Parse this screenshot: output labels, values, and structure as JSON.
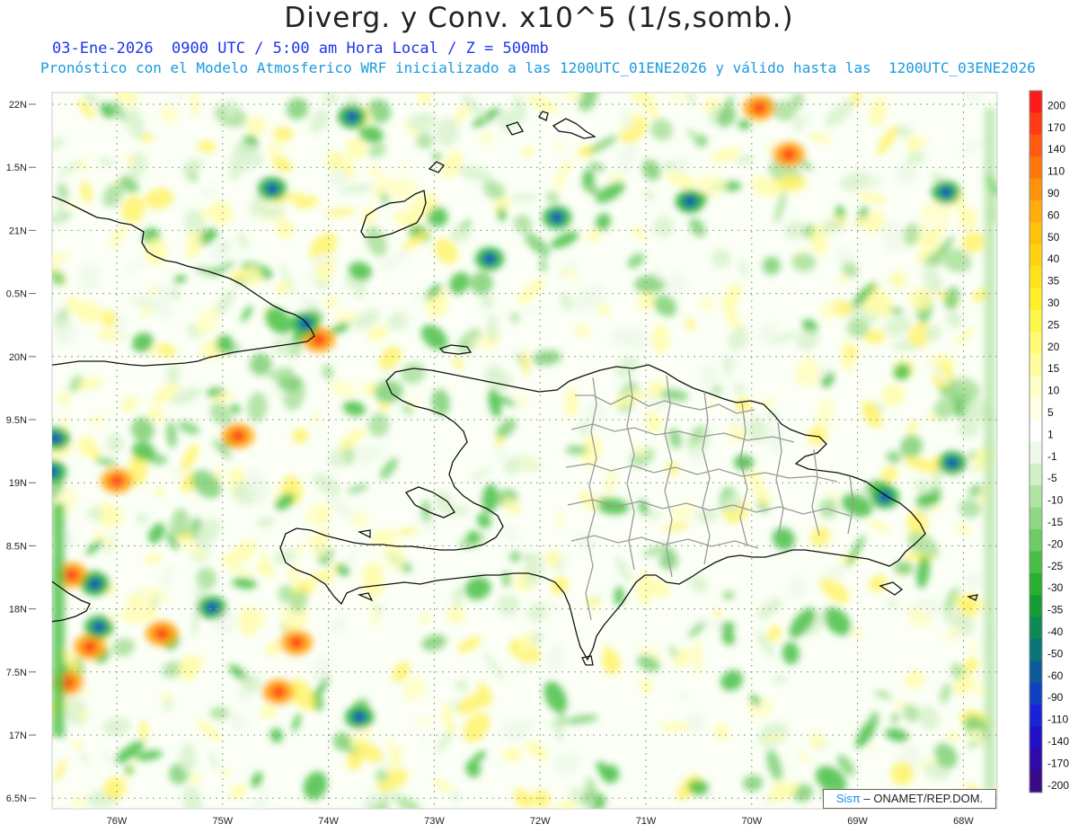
{
  "header": {
    "title": "Diverg. y Conv. x10^5 (1/s,somb.)",
    "subtitle_date": "03-Ene-2026  0900 UTC / 5:00 am Hora Local / Z = 500mb",
    "subtitle_model": "Pronóstico con el Modelo Atmosferico WRF inicializado a las 1200UTC_01ENE2026 y válido hasta las  1200UTC_03ENE2026"
  },
  "axes": {
    "lat_labels": [
      "22N",
      "1.5N",
      "21N",
      "0.5N",
      "20N",
      "9.5N",
      "19N",
      "8.5N",
      "18N",
      "7.5N",
      "17N",
      "6.5N"
    ],
    "lon_labels": [
      "76W",
      "75W",
      "74W",
      "73W",
      "72W",
      "71W",
      "70W",
      "69W",
      "68W"
    ]
  },
  "colorbar": {
    "levels": [
      "200",
      "170",
      "140",
      "110",
      "90",
      "60",
      "50",
      "40",
      "35",
      "30",
      "25",
      "20",
      "15",
      "10",
      "5",
      "1",
      "-1",
      "-5",
      "-10",
      "-15",
      "-20",
      "-25",
      "-30",
      "-35",
      "-40",
      "-50",
      "-60",
      "-90",
      "-110",
      "-140",
      "-170",
      "-200"
    ],
    "colors": [
      "#ff1a1a",
      "#ff3b14",
      "#ff5a10",
      "#ff760d",
      "#ff920b",
      "#ffad0a",
      "#ffc20a",
      "#ffd40f",
      "#ffe31a",
      "#fff02a",
      "#fff84a",
      "#fffb74",
      "#fffd9c",
      "#fffec4",
      "#fffee6",
      "#ffffff",
      "#eef9ea",
      "#d2f0c8",
      "#b0e4a3",
      "#8fd883",
      "#6ccc63",
      "#48bf44",
      "#27b02e",
      "#159c37",
      "#0c8a53",
      "#0a7476",
      "#0d5a9a",
      "#103fc0",
      "#1a22d8",
      "#2210c8",
      "#2e0aa8",
      "#3a0a86"
    ]
  },
  "credit": {
    "logo_text": "Sisπ",
    "text": "– ONAMET/REP.DOM."
  }
}
